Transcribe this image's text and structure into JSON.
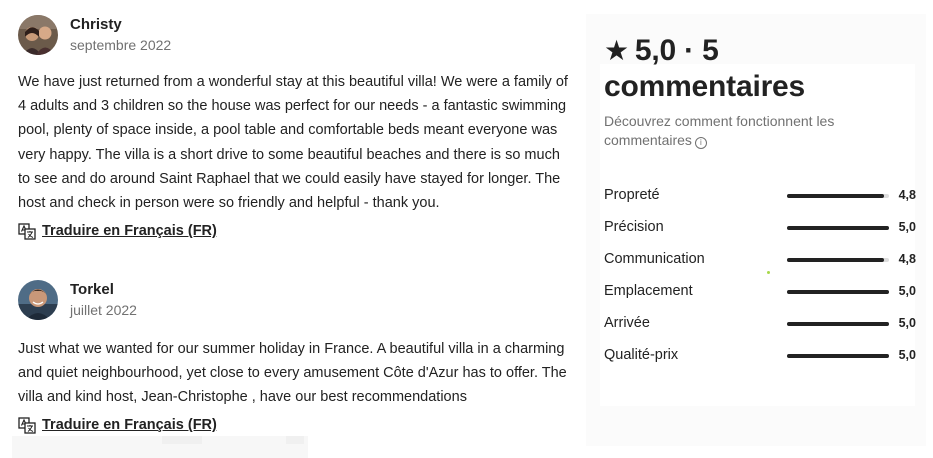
{
  "reviews": [
    {
      "name": "Christy",
      "date": "septembre 2022",
      "text": "We have just returned from a wonderful stay at this beautiful villa! We were a family of 4 adults and 3 children so the house was perfect for our needs - a fantastic swimming pool, plenty of space inside, a pool table and comfortable beds meant everyone was very happy. The villa is a short drive to some beautiful beaches and there is so much to see and do around Saint Raphael that we could easily have stayed for longer. The host and check in person were so friendly and helpful - thank you.",
      "translate_label": "Traduire en Français (FR)"
    },
    {
      "name": "Torkel",
      "date": "juillet 2022",
      "text": "Just what we wanted for our summer holiday in France. A beautiful villa in a charming and quiet neighbourhood, yet close to every amusement Côte d'Azur has to offer. The villa and kind host, Jean-Christophe , have our best recommendations",
      "translate_label": "Traduire en Français (FR)"
    }
  ],
  "summary": {
    "star_icon": "star-icon",
    "rating": "5,0",
    "separator": "·",
    "count_text": "5 commentaires",
    "learn_more": "Découvrez comment fonctionnent les commentaires",
    "info_icon_glyph": "i"
  },
  "categories": [
    {
      "label": "Propreté",
      "score": "4,8",
      "value": 4.8
    },
    {
      "label": "Précision",
      "score": "5,0",
      "value": 5.0
    },
    {
      "label": "Communication",
      "score": "4,8",
      "value": 4.8
    },
    {
      "label": "Emplacement",
      "score": "5,0",
      "value": 5.0
    },
    {
      "label": "Arrivée",
      "score": "5,0",
      "value": 5.0
    },
    {
      "label": "Qualité-prix",
      "score": "5,0",
      "value": 5.0
    }
  ],
  "rating_max": 5,
  "colors": {
    "text": "#222222",
    "muted": "#717171",
    "track": "#dddddd",
    "accent_dot": "#a8d84a"
  }
}
